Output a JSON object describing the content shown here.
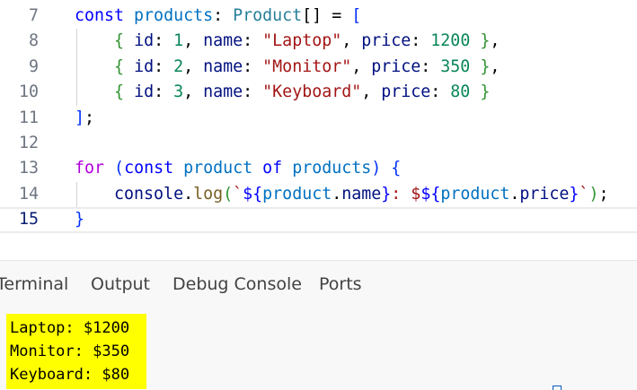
{
  "editor": {
    "line_numbers": [
      "7",
      "8",
      "9",
      "10",
      "11",
      "12",
      "13",
      "14",
      "15"
    ],
    "current_line": "15",
    "lines": [
      [
        [
          "kw",
          "const"
        ],
        [
          "t",
          " "
        ],
        [
          "var",
          "products"
        ],
        [
          "t",
          ": "
        ],
        [
          "type",
          "Product"
        ],
        [
          "t",
          "[] = "
        ],
        [
          "br1",
          "["
        ]
      ],
      [
        [
          "t",
          "    "
        ],
        [
          "br2",
          "{"
        ],
        [
          "t",
          " "
        ],
        [
          "prop",
          "id"
        ],
        [
          "t",
          ": "
        ],
        [
          "num",
          "1"
        ],
        [
          "t",
          ", "
        ],
        [
          "prop",
          "name"
        ],
        [
          "t",
          ": "
        ],
        [
          "str",
          "\"Laptop\""
        ],
        [
          "t",
          ", "
        ],
        [
          "prop",
          "price"
        ],
        [
          "t",
          ": "
        ],
        [
          "num",
          "1200"
        ],
        [
          "t",
          " "
        ],
        [
          "br2",
          "}"
        ],
        [
          "t",
          ","
        ]
      ],
      [
        [
          "t",
          "    "
        ],
        [
          "br2",
          "{"
        ],
        [
          "t",
          " "
        ],
        [
          "prop",
          "id"
        ],
        [
          "t",
          ": "
        ],
        [
          "num",
          "2"
        ],
        [
          "t",
          ", "
        ],
        [
          "prop",
          "name"
        ],
        [
          "t",
          ": "
        ],
        [
          "str",
          "\"Monitor\""
        ],
        [
          "t",
          ", "
        ],
        [
          "prop",
          "price"
        ],
        [
          "t",
          ": "
        ],
        [
          "num",
          "350"
        ],
        [
          "t",
          " "
        ],
        [
          "br2",
          "}"
        ],
        [
          "t",
          ","
        ]
      ],
      [
        [
          "t",
          "    "
        ],
        [
          "br2",
          "{"
        ],
        [
          "t",
          " "
        ],
        [
          "prop",
          "id"
        ],
        [
          "t",
          ": "
        ],
        [
          "num",
          "3"
        ],
        [
          "t",
          ", "
        ],
        [
          "prop",
          "name"
        ],
        [
          "t",
          ": "
        ],
        [
          "str",
          "\"Keyboard\""
        ],
        [
          "t",
          ", "
        ],
        [
          "prop",
          "price"
        ],
        [
          "t",
          ": "
        ],
        [
          "num",
          "80"
        ],
        [
          "t",
          " "
        ],
        [
          "br2",
          "}"
        ]
      ],
      [
        [
          "br1",
          "]"
        ],
        [
          "t",
          ";"
        ]
      ],
      [],
      [
        [
          "ctrl",
          "for"
        ],
        [
          "t",
          " "
        ],
        [
          "br1",
          "("
        ],
        [
          "kw",
          "const"
        ],
        [
          "t",
          " "
        ],
        [
          "var",
          "product"
        ],
        [
          "t",
          " "
        ],
        [
          "kw",
          "of"
        ],
        [
          "t",
          " "
        ],
        [
          "var",
          "products"
        ],
        [
          "br1",
          ")"
        ],
        [
          "t",
          " "
        ],
        [
          "br1",
          "{"
        ]
      ],
      [
        [
          "t",
          "    "
        ],
        [
          "prop",
          "console"
        ],
        [
          "t",
          "."
        ],
        [
          "fn",
          "log"
        ],
        [
          "br2",
          "("
        ],
        [
          "tpl",
          "`"
        ],
        [
          "tplx",
          "${"
        ],
        [
          "var",
          "product"
        ],
        [
          "t",
          "."
        ],
        [
          "prop",
          "name"
        ],
        [
          "tplx",
          "}"
        ],
        [
          "tpl",
          ": $"
        ],
        [
          "tplx",
          "${"
        ],
        [
          "var",
          "product"
        ],
        [
          "t",
          "."
        ],
        [
          "prop",
          "price"
        ],
        [
          "tplx",
          "}"
        ],
        [
          "tpl",
          "`"
        ],
        [
          "br2",
          ")"
        ],
        [
          "t",
          ";"
        ]
      ],
      [
        [
          "br1",
          "}"
        ]
      ]
    ]
  },
  "panel": {
    "tabs": [
      "Terminal",
      "Output",
      "Debug Console",
      "Ports"
    ],
    "active_tab": "Terminal",
    "output": [
      "Laptop: $1200",
      "Monitor: $350",
      "Keyboard: $80"
    ]
  },
  "colors": {
    "keyword": "#0000ff",
    "control": "#af00db",
    "variable": "#0070c1",
    "type": "#267f99",
    "string": "#a31515",
    "number": "#098658",
    "property": "#001080",
    "function": "#795e26",
    "highlight": "#ffff00"
  }
}
